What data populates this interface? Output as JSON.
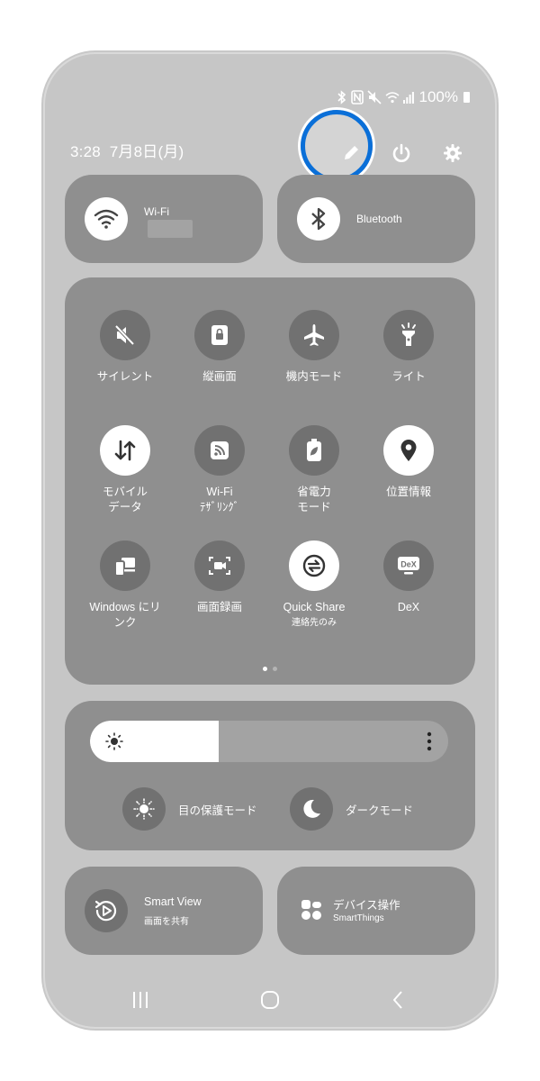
{
  "status": {
    "battery_pct": "100%"
  },
  "header": {
    "time": "3:28",
    "date": "7月8日(月)"
  },
  "big_tiles": {
    "wifi": {
      "label": "Wi-Fi"
    },
    "bluetooth": {
      "label": "Bluetooth"
    }
  },
  "quick_settings": [
    {
      "label": "サイレント",
      "sub": "",
      "icon": "mute-icon",
      "on": false
    },
    {
      "label": "縦画面",
      "sub": "",
      "icon": "portrait-lock-icon",
      "on": false
    },
    {
      "label": "機内モード",
      "sub": "",
      "icon": "airplane-icon",
      "on": false
    },
    {
      "label": "ライト",
      "sub": "",
      "icon": "flashlight-icon",
      "on": false
    },
    {
      "label": "モバイル\nデータ",
      "sub": "",
      "icon": "mobile-data-icon",
      "on": true
    },
    {
      "label": "Wi-Fi\nﾃｻﾞﾘﾝｸﾞ",
      "sub": "",
      "icon": "hotspot-icon",
      "on": false
    },
    {
      "label": "省電力\nモード",
      "sub": "",
      "icon": "power-saving-icon",
      "on": false
    },
    {
      "label": "位置情報",
      "sub": "",
      "icon": "location-icon",
      "on": true
    },
    {
      "label": "Windows にリ\nンク",
      "sub": "",
      "icon": "link-to-windows-icon",
      "on": false
    },
    {
      "label": "画面録画",
      "sub": "",
      "icon": "screen-record-icon",
      "on": false
    },
    {
      "label": "Quick Share",
      "sub": "連絡先のみ",
      "icon": "quick-share-icon",
      "on": true
    },
    {
      "label": "DeX",
      "sub": "",
      "icon": "dex-icon",
      "on": false
    }
  ],
  "brightness": {
    "level": 0.36
  },
  "modes": {
    "eye_comfort": "目の保護モード",
    "dark_mode": "ダークモード"
  },
  "bottom_tiles": {
    "smart_view": {
      "label": "Smart View",
      "sub": "画面を共有"
    },
    "device_control": {
      "label": "デバイス操作",
      "sub": "SmartThings"
    }
  },
  "colors": {
    "highlight_ring": "#0a6fd8",
    "panel_bg": "#c6c6c6",
    "tile_bg": "#8f8f8f"
  }
}
